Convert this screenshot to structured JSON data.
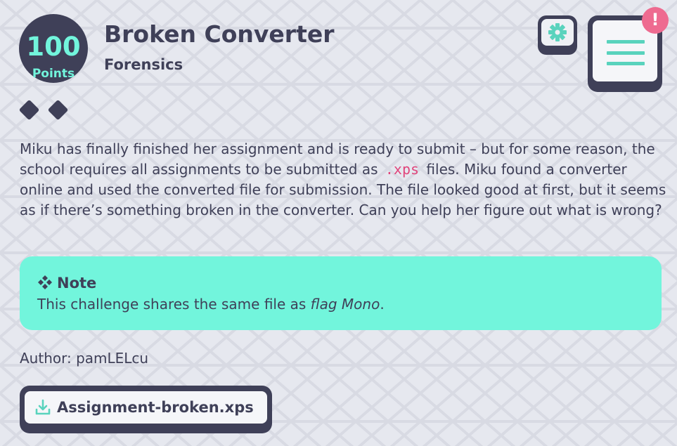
{
  "challenge": {
    "points_value": "100",
    "points_unit": "Points",
    "title": "Broken Converter",
    "category": "Forensics",
    "difficulty_diamonds": 2,
    "description_before": "Miku has finally finished her assignment and is ready to submit – but for some reason, the school requires all assignments to be submitted as",
    "description_code": ".xps",
    "description_after": "files. Miku found a converter online and used the converted file for submission. The file looked good at first, but it seems as if there’s something broken in the converter. Can you help her figure out what is wrong?",
    "note": {
      "icon": "diamond-cluster-icon",
      "title": "Note",
      "text_before": "This challenge shares the same file as ",
      "text_emphasis": "flag Mono",
      "text_after": "."
    },
    "author": "Author: pamLELcu",
    "download": {
      "icon": "download-icon",
      "filename": "Assignment-broken.xps"
    }
  },
  "toolbar": {
    "settings_icon": "gear-icon",
    "menu_icon": "notes-menu-icon",
    "alert_text": "!"
  },
  "colors": {
    "background": "#e6e8ef",
    "text": "#3f4058",
    "accent": "#72f5dc",
    "teal_icon": "#59d3bd",
    "alert": "#ee6b90",
    "code": "#e0457b"
  }
}
